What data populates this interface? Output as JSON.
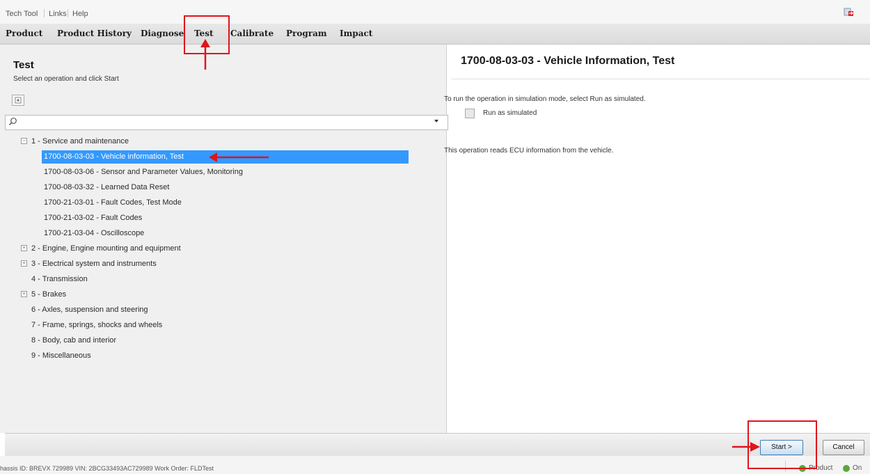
{
  "top_menu": {
    "items": [
      "Tech Tool",
      "Links",
      "Help"
    ]
  },
  "tabs": [
    "Product",
    "Product History",
    "Diagnose",
    "Test",
    "Calibrate",
    "Program",
    "Impact"
  ],
  "left_panel": {
    "title": "Test",
    "subtitle": "Select an operation and click Start",
    "search": {
      "value": "",
      "placeholder": ""
    },
    "tree": [
      {
        "label": "1 - Service and maintenance",
        "expanded": true
      },
      {
        "label": "1700-08-03-03 - Vehicle information, Test",
        "selected": true
      },
      {
        "label": "1700-08-03-06 - Sensor and Parameter Values, Monitoring"
      },
      {
        "label": "1700-08-03-32 - Learned Data Reset"
      },
      {
        "label": "1700-21-03-01 - Fault Codes, Test Mode"
      },
      {
        "label": "1700-21-03-02 - Fault Codes"
      },
      {
        "label": "1700-21-03-04 - Oscilloscope"
      },
      {
        "label": "2 - Engine, Engine mounting and equipment",
        "collapsed": true
      },
      {
        "label": "3 - Electrical system and instruments",
        "collapsed": true
      },
      {
        "label": "4 - Transmission"
      },
      {
        "label": "5 - Brakes",
        "collapsed": true
      },
      {
        "label": "6 - Axles, suspension and steering"
      },
      {
        "label": "7 - Frame, springs, shocks and wheels"
      },
      {
        "label": "8 - Body, cab and interior"
      },
      {
        "label": "9 - Miscellaneous"
      }
    ]
  },
  "right_panel": {
    "title": "1700-08-03-03 - Vehicle Information, Test",
    "simulation_instruction": "To run the operation in simulation mode, select Run as simulated.",
    "simulation_checkbox_label": "Run as simulated",
    "simulation_checked": false,
    "description": "This operation reads ECU information from the vehicle."
  },
  "buttons": {
    "start": "Start >",
    "cancel": "Cancel"
  },
  "status_bar": {
    "text": "hassis ID: BREVX 729989    VIN: 2BCG33493AC729989    Work Order: FLDTest",
    "items": [
      "Product",
      "On"
    ]
  },
  "colors": {
    "selection": "#3399ff",
    "annotation": "#e0141b",
    "status_ok": "#5aa73c"
  }
}
